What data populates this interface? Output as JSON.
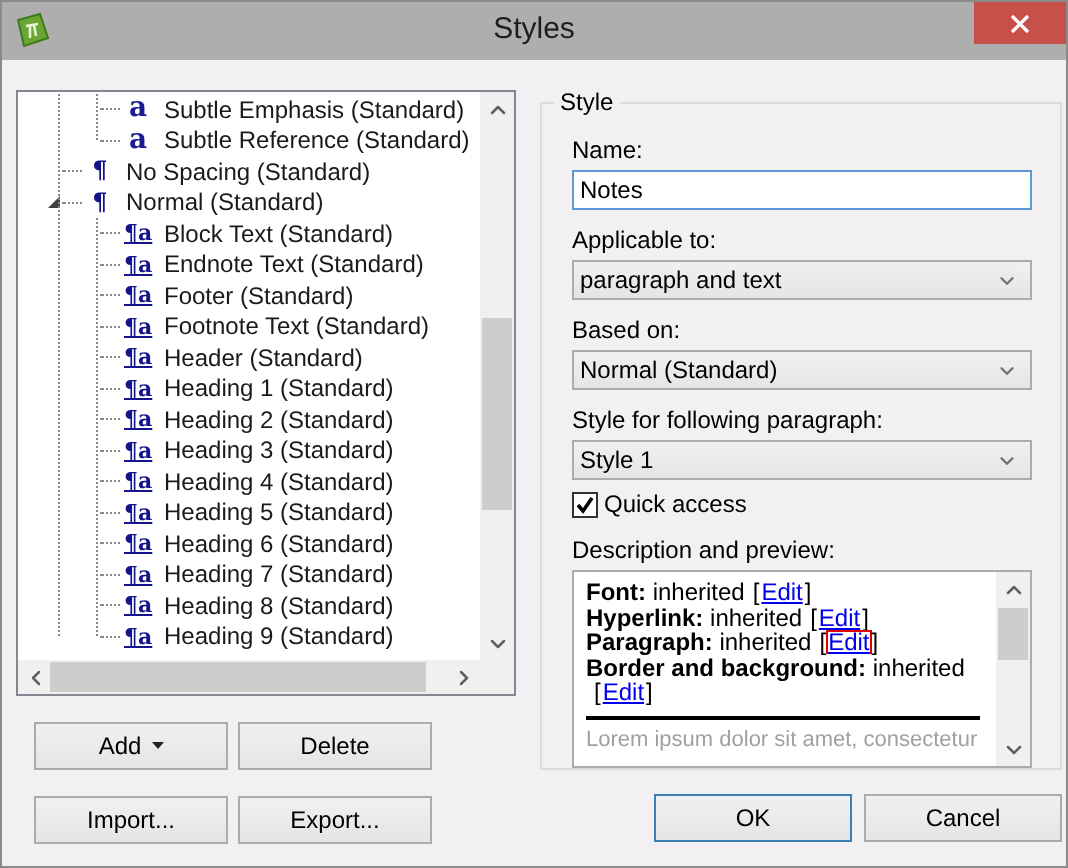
{
  "window": {
    "title": "Styles"
  },
  "tree": {
    "continued_items": [
      {
        "kind": "character",
        "icon": "a",
        "label": "Subtle Emphasis (Standard)"
      },
      {
        "kind": "character",
        "icon": "a",
        "label": "Subtle Reference (Standard)"
      }
    ],
    "items": [
      {
        "kind": "paragraph",
        "icon": "¶",
        "label": "No Spacing (Standard)"
      },
      {
        "kind": "paragraph",
        "icon": "¶",
        "label": "Normal (Standard)",
        "expanded": true,
        "children": [
          {
            "kind": "linked",
            "icon": "¶a",
            "label": "Block Text (Standard)"
          },
          {
            "kind": "linked",
            "icon": "¶a",
            "label": "Endnote Text (Standard)"
          },
          {
            "kind": "linked",
            "icon": "¶a",
            "label": "Footer (Standard)"
          },
          {
            "kind": "linked",
            "icon": "¶a",
            "label": "Footnote Text (Standard)"
          },
          {
            "kind": "linked",
            "icon": "¶a",
            "label": "Header (Standard)"
          },
          {
            "kind": "linked",
            "icon": "¶a",
            "label": "Heading 1 (Standard)"
          },
          {
            "kind": "linked",
            "icon": "¶a",
            "label": "Heading 2 (Standard)"
          },
          {
            "kind": "linked",
            "icon": "¶a",
            "label": "Heading 3 (Standard)"
          },
          {
            "kind": "linked",
            "icon": "¶a",
            "label": "Heading 4 (Standard)"
          },
          {
            "kind": "linked",
            "icon": "¶a",
            "label": "Heading 5 (Standard)"
          },
          {
            "kind": "linked",
            "icon": "¶a",
            "label": "Heading 6 (Standard)"
          },
          {
            "kind": "linked",
            "icon": "¶a",
            "label": "Heading 7 (Standard)"
          },
          {
            "kind": "linked",
            "icon": "¶a",
            "label": "Heading 8 (Standard)"
          },
          {
            "kind": "linked",
            "icon": "¶a",
            "label": "Heading 9 (Standard)"
          }
        ]
      }
    ]
  },
  "left_buttons": [
    {
      "label": "Add",
      "kind": "menu"
    },
    {
      "label": "Delete",
      "kind": "plain"
    },
    {
      "label": "Import...",
      "kind": "plain"
    },
    {
      "label": "Export...",
      "kind": "plain"
    }
  ],
  "style_group": {
    "legend": "Style",
    "name": {
      "label": "Name:",
      "value": "Notes",
      "focused": true
    },
    "selects": [
      {
        "label": "Applicable to:",
        "value": "paragraph and text"
      },
      {
        "label": "Based on:",
        "value": "Normal (Standard)"
      },
      {
        "label": "Style for following paragraph:",
        "value": "Style 1"
      }
    ],
    "quick_access": {
      "label": "Quick access",
      "checked": true
    },
    "description": {
      "label": "Description and preview:",
      "lines": [
        {
          "text": "**Font:** inherited",
          "link_open": "[",
          "link": "Edit",
          "link_close": "]",
          "focused": false
        },
        {
          "text": "**Hyperlink:** inherited",
          "link_open": "[",
          "link": "Edit",
          "link_close": "]",
          "focused": false
        },
        {
          "text": "**Paragraph:** inherited",
          "link_open": "[",
          "link": "Edit",
          "link_close": "]",
          "focused": true
        },
        {
          "text": "**Border and background:** inherited",
          "link_open": "[",
          "link": "Edit",
          "link_close": "]",
          "focused": false
        }
      ],
      "preview": "Lorem ipsum dolor sit amet, consectetur"
    }
  },
  "dialog_buttons": [
    {
      "label": "OK",
      "default": true
    },
    {
      "label": "Cancel",
      "default": false
    }
  ]
}
